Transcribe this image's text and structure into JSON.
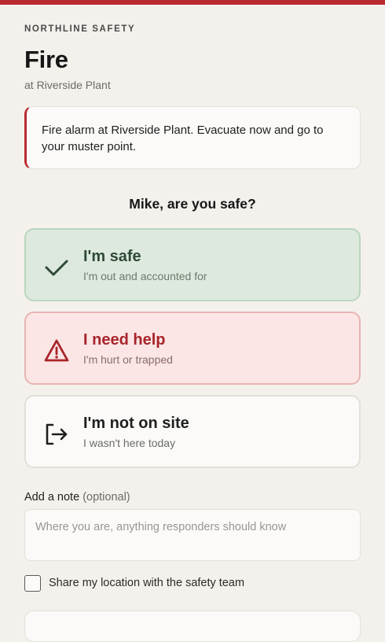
{
  "header": {
    "brand": "NORTHLINE SAFETY",
    "title": "Fire",
    "subtitle": "at Riverside Plant"
  },
  "alert": {
    "message": "Fire alarm at Riverside Plant. Evacuate now and go to your muster point."
  },
  "question": "Mike, are you safe?",
  "options": [
    {
      "label": "I'm safe",
      "description": "I'm out and accounted for",
      "icon": "checkmark-icon"
    },
    {
      "label": "I need help",
      "description": "I'm hurt or trapped",
      "icon": "warning-triangle-icon"
    },
    {
      "label": "I'm not on site",
      "description": "I wasn't here today",
      "icon": "exit-icon"
    }
  ],
  "note": {
    "label": "Add a note",
    "optional": "(optional)",
    "placeholder": "Where you are, anything responders should know",
    "value": ""
  },
  "share_location": {
    "label": "Share my location with the safety team",
    "checked": false
  },
  "colors": {
    "accent_red": "#b82a2e",
    "safe_bg": "#dde9df",
    "help_bg": "#fbe6e5",
    "page_bg": "#f4f1ec"
  }
}
